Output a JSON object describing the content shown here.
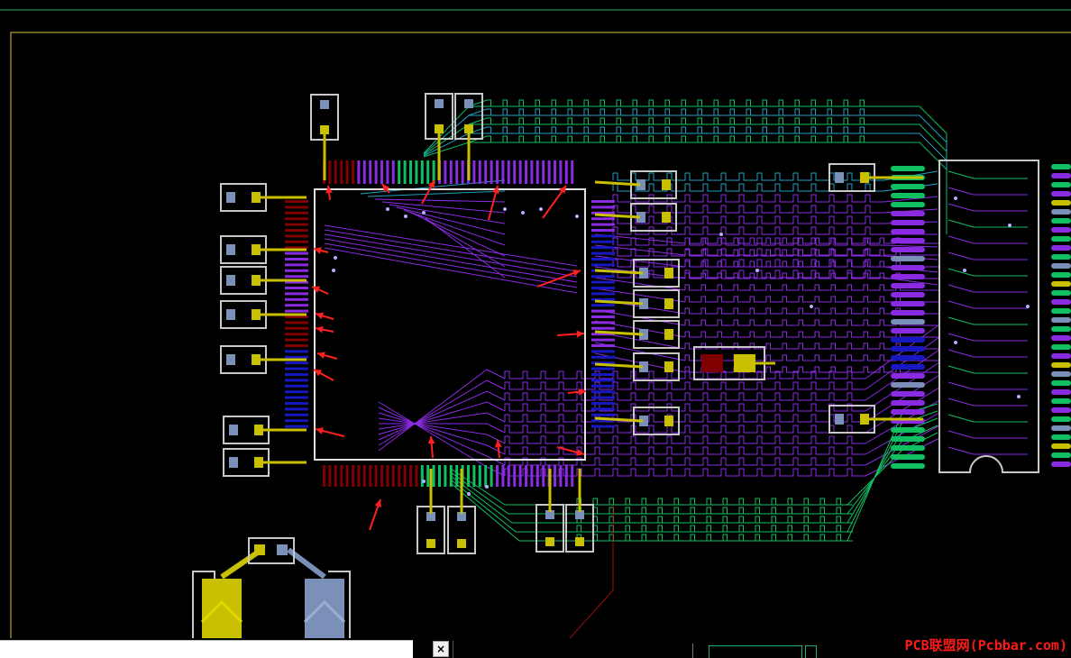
{
  "window": {
    "close_glyph": "×"
  },
  "watermark": {
    "text": "PCB联盟网(Pcbbar.com)"
  },
  "colors": {
    "background": "#000000",
    "board_outline": "#d8c040",
    "top_line": "#20b060",
    "chip_outline": "#e0e0e0",
    "pad_outline": "#c8c8c8",
    "pad_blue": "#7a90b8",
    "pad_yellow": "#c8c000",
    "trace_purple": "#8a2be2",
    "trace_green": "#10c060",
    "trace_cyan": "#20a0c0",
    "pin_darkred": "#800000",
    "pin_blue": "#1818c0",
    "arrow_red": "#ff2020"
  },
  "icons": {
    "arrow": "red-arrow-icon",
    "close": "close-icon"
  }
}
